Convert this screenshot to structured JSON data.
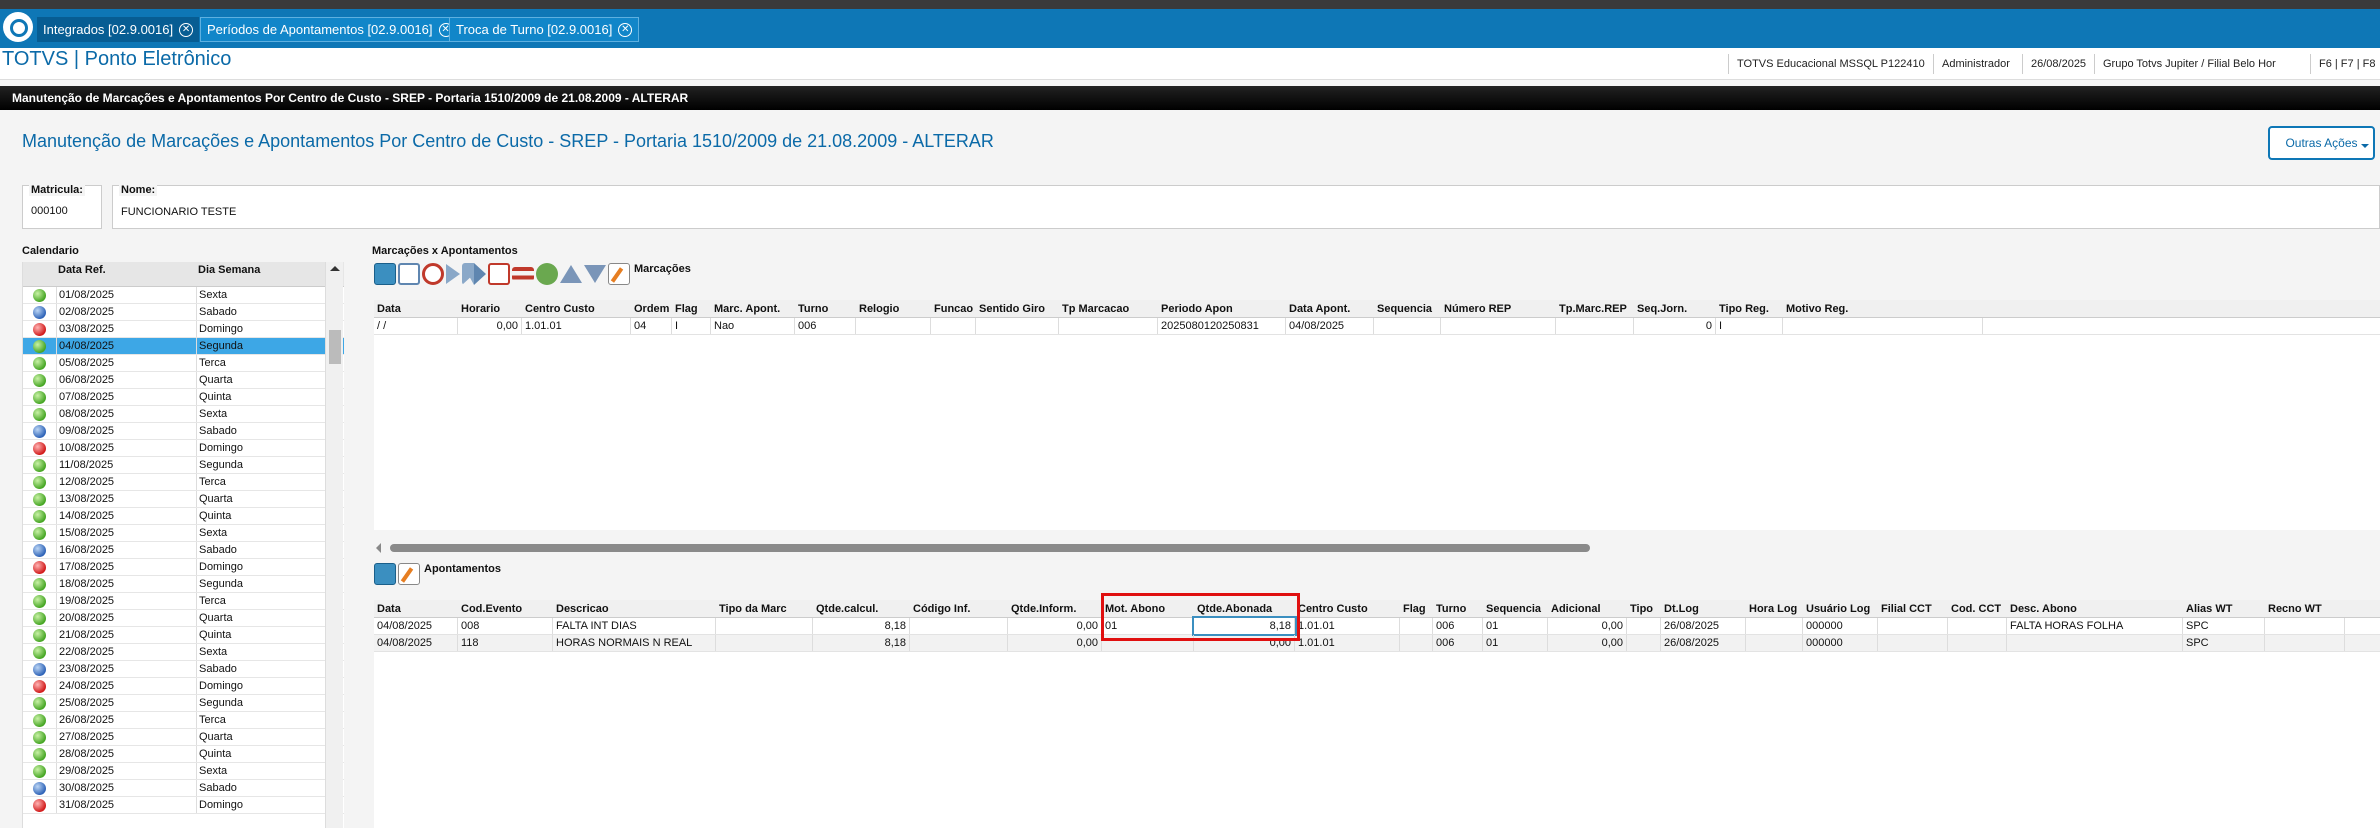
{
  "tabs": [
    {
      "label": "Integrados [02.9.0016]"
    },
    {
      "label": "Períodos de Apontamentos [02.9.0016]"
    },
    {
      "label": "Troca de Turno [02.9.0016]"
    }
  ],
  "app": {
    "title": "TOTVS | Ponto Eletrônico",
    "status": [
      "TOTVS Educacional MSSQL P122410",
      "Administrador",
      "26/08/2025",
      "Grupo Totvs Jupiter / Filial Belo Hor",
      "F6 | F7 | F8"
    ]
  },
  "window_title": "Manutenção de Marcações e Apontamentos Por Centro de Custo - SREP - Portaria 1510/2009 de 21.08.2009 - ALTERAR",
  "page_title": "Manutenção de Marcações e Apontamentos Por Centro de Custo - SREP - Portaria 1510/2009 de 21.08.2009 - ALTERAR",
  "outras_acoes": "Outras Ações",
  "matricula": {
    "label": "Matricula:",
    "value": "000100"
  },
  "nome": {
    "label": "Nome:",
    "value": "FUNCIONARIO TESTE"
  },
  "calendario": {
    "label": "Calendario",
    "col_data": "Data Ref.",
    "col_dia": "Dia Semana",
    "rows": [
      {
        "data": "01/08/2025",
        "dia": "Sexta",
        "status": "green"
      },
      {
        "data": "02/08/2025",
        "dia": "Sabado",
        "status": "blue"
      },
      {
        "data": "03/08/2025",
        "dia": "Domingo",
        "status": "red"
      },
      {
        "data": "04/08/2025",
        "dia": "Segunda",
        "status": "green"
      },
      {
        "data": "05/08/2025",
        "dia": "Terca",
        "status": "green"
      },
      {
        "data": "06/08/2025",
        "dia": "Quarta",
        "status": "green"
      },
      {
        "data": "07/08/2025",
        "dia": "Quinta",
        "status": "green"
      },
      {
        "data": "08/08/2025",
        "dia": "Sexta",
        "status": "green"
      },
      {
        "data": "09/08/2025",
        "dia": "Sabado",
        "status": "blue"
      },
      {
        "data": "10/08/2025",
        "dia": "Domingo",
        "status": "red"
      },
      {
        "data": "11/08/2025",
        "dia": "Segunda",
        "status": "green"
      },
      {
        "data": "12/08/2025",
        "dia": "Terca",
        "status": "green"
      },
      {
        "data": "13/08/2025",
        "dia": "Quarta",
        "status": "green"
      },
      {
        "data": "14/08/2025",
        "dia": "Quinta",
        "status": "green"
      },
      {
        "data": "15/08/2025",
        "dia": "Sexta",
        "status": "green"
      },
      {
        "data": "16/08/2025",
        "dia": "Sabado",
        "status": "blue"
      },
      {
        "data": "17/08/2025",
        "dia": "Domingo",
        "status": "red"
      },
      {
        "data": "18/08/2025",
        "dia": "Segunda",
        "status": "green"
      },
      {
        "data": "19/08/2025",
        "dia": "Terca",
        "status": "green"
      },
      {
        "data": "20/08/2025",
        "dia": "Quarta",
        "status": "green"
      },
      {
        "data": "21/08/2025",
        "dia": "Quinta",
        "status": "green"
      },
      {
        "data": "22/08/2025",
        "dia": "Sexta",
        "status": "green"
      },
      {
        "data": "23/08/2025",
        "dia": "Sabado",
        "status": "blue"
      },
      {
        "data": "24/08/2025",
        "dia": "Domingo",
        "status": "red"
      },
      {
        "data": "25/08/2025",
        "dia": "Segunda",
        "status": "green"
      },
      {
        "data": "26/08/2025",
        "dia": "Terca",
        "status": "green"
      },
      {
        "data": "27/08/2025",
        "dia": "Quarta",
        "status": "green"
      },
      {
        "data": "28/08/2025",
        "dia": "Quinta",
        "status": "green"
      },
      {
        "data": "29/08/2025",
        "dia": "Sexta",
        "status": "green"
      },
      {
        "data": "30/08/2025",
        "dia": "Sabado",
        "status": "blue"
      },
      {
        "data": "31/08/2025",
        "dia": "Domingo",
        "status": "red"
      }
    ],
    "selected": "04/08/2025"
  },
  "marcacoes": {
    "section_label": "Marcações x Apontamentos",
    "toolbar_label": "Marcações",
    "columns": [
      "Data",
      "Horario",
      "Centro Custo",
      "Ordem",
      "Flag",
      "Marc. Apont.",
      "Turno",
      "Relogio",
      "Funcao",
      "Sentido Giro",
      "Tp Marcacao",
      "Periodo Apon",
      "Data Apont.",
      "Sequencia",
      "Número REP",
      "Tp.Marc.REP",
      "Seq.Jorn.",
      "Tipo Reg.",
      "Motivo Reg."
    ],
    "rows": [
      [
        "/ /",
        "0,00",
        "1.01.01",
        "04",
        "I",
        "Nao",
        "006",
        "",
        "",
        "",
        "",
        "2025080120250831",
        "04/08/2025",
        "",
        "",
        "",
        "0",
        "I",
        ""
      ]
    ]
  },
  "apontamentos": {
    "toolbar_label": "Apontamentos",
    "columns": [
      "Data",
      "Cod.Evento",
      "Descricao",
      "Tipo da Marc",
      "Qtde.calcul.",
      "Código Inf.",
      "Qtde.Inform.",
      "Mot. Abono",
      "Qtde.Abonada",
      "Centro Custo",
      "Flag",
      "Turno",
      "Sequencia",
      "Adicional",
      "Tipo",
      "Dt.Log",
      "Hora Log",
      "Usuário Log",
      "Filial CCT",
      "Cod. CCT",
      "Desc. Abono",
      "Alias WT",
      "Recno WT"
    ],
    "rows": [
      [
        "04/08/2025",
        "008",
        "FALTA INT DIAS",
        "",
        "8,18",
        "",
        "0,00",
        "01",
        "8,18",
        "1.01.01",
        "",
        "006",
        "01",
        "0,00",
        "",
        "26/08/2025",
        "",
        "000000",
        "",
        "",
        "FALTA HORAS FOLHA",
        "SPC",
        ""
      ],
      [
        "04/08/2025",
        "118",
        "HORAS NORMAIS N REAL",
        "",
        "8,18",
        "",
        "0,00",
        "",
        "0,00",
        "1.01.01",
        "",
        "006",
        "01",
        "0,00",
        "",
        "26/08/2025",
        "",
        "000000",
        "",
        "",
        "",
        "SPC",
        ""
      ]
    ]
  }
}
